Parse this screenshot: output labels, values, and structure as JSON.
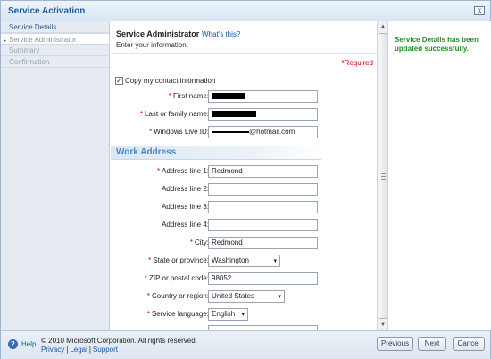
{
  "window": {
    "title": "Service Activation",
    "close_label": "x"
  },
  "sidebar": {
    "items": [
      {
        "label": "Service Details",
        "state": "completed"
      },
      {
        "label": "Service Administrator",
        "state": "current"
      },
      {
        "label": "Summary",
        "state": "pending"
      },
      {
        "label": "Confirmation",
        "state": "pending"
      }
    ]
  },
  "main": {
    "heading": "Service Administrator",
    "whats_this": "What's this?",
    "subtitle": "Enter your information.",
    "required_note": "*Required",
    "copy_contact_label": "Copy my contact information",
    "copy_contact_checked": true,
    "section_title": "Work Address",
    "fields": {
      "first_name": {
        "label": "First name:",
        "required": "*",
        "value": ""
      },
      "last_name": {
        "label": "Last or family name:",
        "required": "*",
        "value": ""
      },
      "windows_live_id": {
        "label": "Windows Live ID:",
        "required": "*",
        "value_suffix": "@hotmail.com"
      },
      "address1": {
        "label": "Address line 1:",
        "required": "*",
        "value": "Redmond"
      },
      "address2": {
        "label": "Address line 2:",
        "value": ""
      },
      "address3": {
        "label": "Address line 3:",
        "value": ""
      },
      "address4": {
        "label": "Address line 4:",
        "value": ""
      },
      "city": {
        "label": "City:",
        "required": "*",
        "value": "Redmond"
      },
      "state": {
        "label": "State or province:",
        "required": "*",
        "value": "Washington"
      },
      "zip": {
        "label": "ZIP or postal code:",
        "required": "*",
        "value": "98052"
      },
      "country": {
        "label": "Country or region:",
        "required": "*",
        "value": "United States"
      },
      "language": {
        "label": "Service language:",
        "required": "*",
        "value": "English"
      }
    }
  },
  "right_panel": {
    "message": "Service Details has been updated successfully."
  },
  "footer": {
    "help": "Help",
    "copyright": "© 2010 Microsoft Corporation. All rights reserved.",
    "privacy": "Privacy",
    "legal": "Legal",
    "support": "Support",
    "buttons": {
      "previous": "Previous",
      "next": "Next",
      "cancel": "Cancel"
    }
  },
  "icons": {
    "help": "help-circle-icon",
    "close": "close-icon",
    "dropdown": "chevron-down-icon"
  },
  "colors": {
    "accent": "#1f5a9e",
    "success": "#2a8a2a",
    "required": "#cc0000"
  }
}
